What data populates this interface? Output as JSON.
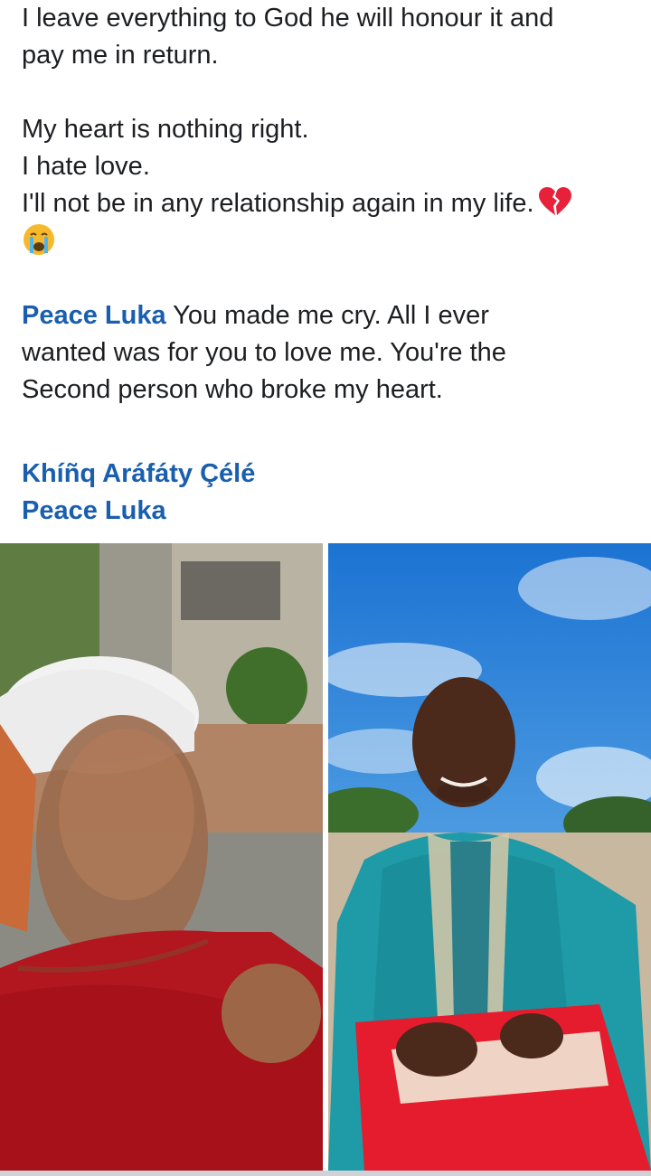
{
  "post": {
    "line1": "I leave everything to God he will honour it and",
    "line2": "pay me in return.",
    "line3": "My heart is nothing right.",
    "line4": "I hate love.",
    "line5": "I'll not be in any relationship again in my life.",
    "comment_author": "Peace Luka",
    "comment_line1": "  You made me cry. All I ever",
    "comment_line2": "wanted was for you to love me. You're the",
    "comment_line3": "Second person who broke my heart.",
    "tag1": "Khíñq Aráfáty Çélé",
    "tag2": "Peace Luka",
    "emojis": [
      "broken-heart",
      "crying-face"
    ]
  },
  "colors": {
    "mention": "#1a5fad",
    "text": "#1c1e21"
  }
}
